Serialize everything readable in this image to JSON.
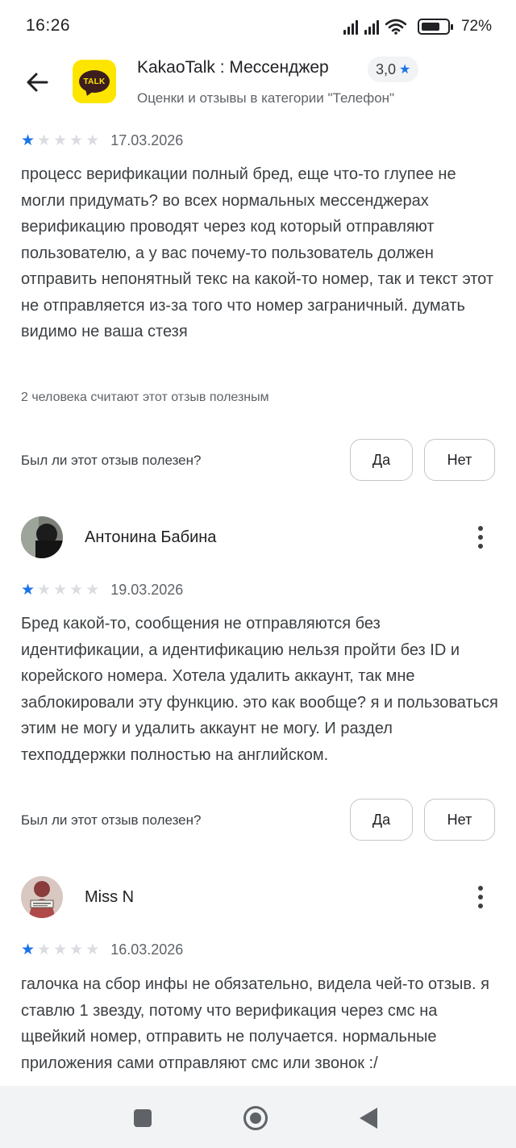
{
  "status_bar": {
    "time": "16:26",
    "battery_percent": "72%",
    "battery_level": 0.72
  },
  "header": {
    "app_name": "KakaoTalk : Мессенджер",
    "rating": "3,0",
    "subtitle": "Оценки и отзывы в категории \"Телефон\"",
    "app_icon_text": "TALK",
    "colors": {
      "icon_bg": "#FEE500",
      "accent": "#1a73e8"
    }
  },
  "reviews": [
    {
      "rating": 1,
      "date": "17.03.2026",
      "text": "процесс верификации полный бред, еще что-то глупее не могли придумать? во всех нормальных мессенджерах верификацию проводят через код который отправляют пользователю, а у вас почему-то пользователь должен отправить непонятный текс на какой-то номер, так и текст этот не отправляется из-за того что номер заграничный. думать видимо не ваша стезя",
      "helpful_count_text": "2 человека считают этот отзыв полезным",
      "helpful_question": "Был ли этот отзыв полезен?",
      "yes_label": "Да",
      "no_label": "Нет"
    },
    {
      "author": "Антонина Бабина",
      "rating": 1,
      "date": "19.03.2026",
      "text": "Бред какой-то, сообщения не отправляются без идентификации, а идентификацию нельзя пройти без ID и корейского номера. Хотела удалить аккаунт, так мне заблокировали эту функцию. это как вообще? я и пользоваться этим не могу и удалить аккаунт не могу. И раздел техподдержки полностью на английском.",
      "helpful_question": "Был ли этот отзыв полезен?",
      "yes_label": "Да",
      "no_label": "Нет"
    },
    {
      "author": "Miss N",
      "rating": 1,
      "date": "16.03.2026",
      "text": "галочка на сбор инфы не обязательно, видела чей-то отзыв. я ставлю 1 звезду, потому что верификация через смс на щвейкий номер, отправить не получается. нормальные приложения сами отправляют смс или звонок :/"
    }
  ],
  "icons": {
    "back": "arrow-back-icon",
    "more": "more-vert-icon",
    "star": "star-icon",
    "nav_recents": "square-icon",
    "nav_home": "circle-icon",
    "nav_back": "triangle-back-icon"
  }
}
